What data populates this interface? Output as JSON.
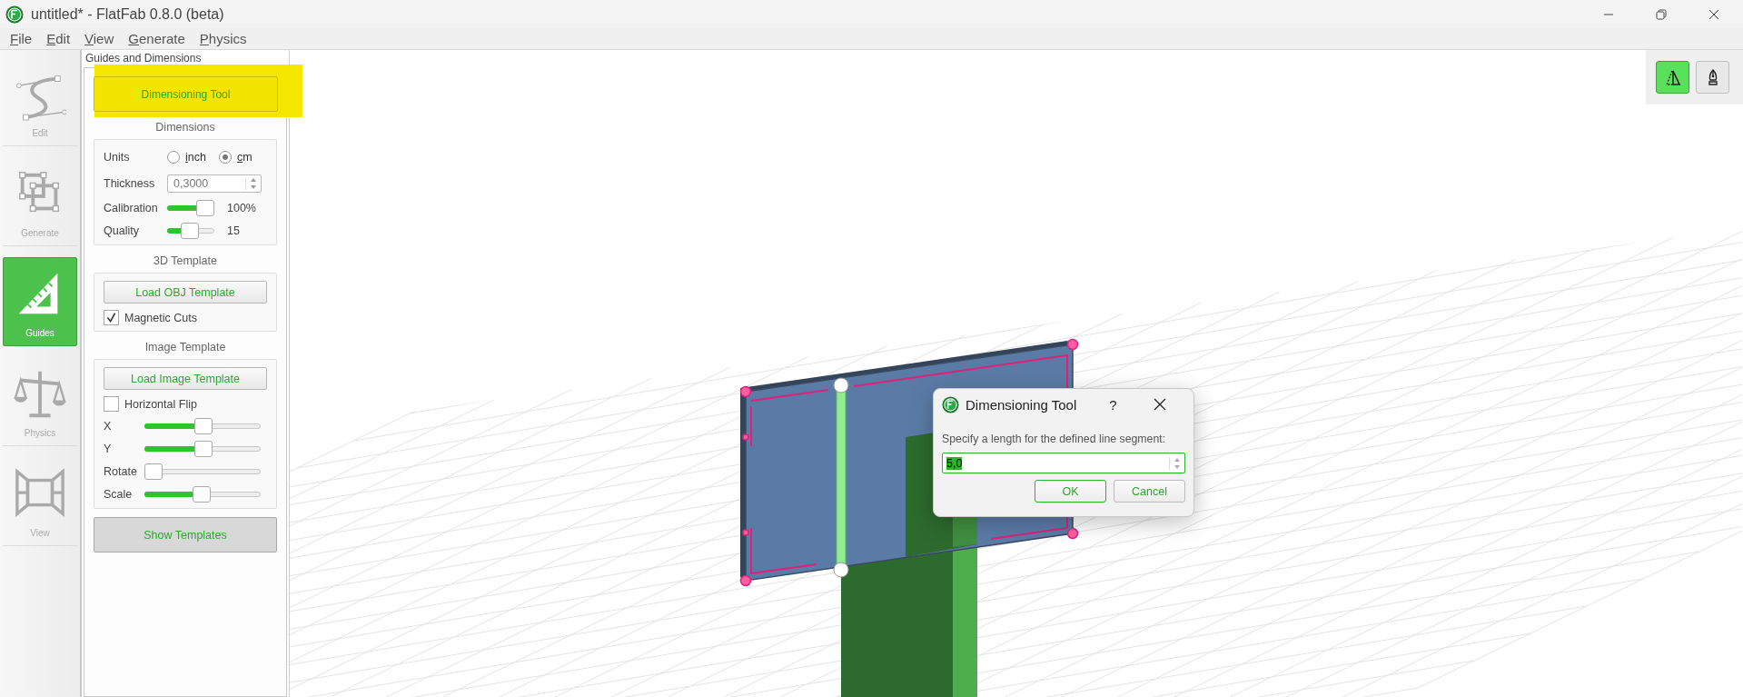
{
  "window": {
    "title": "untitled* - FlatFab 0.8.0 (beta)"
  },
  "menu": [
    {
      "label": "File"
    },
    {
      "label": "Edit"
    },
    {
      "label": "View"
    },
    {
      "label": "Generate"
    },
    {
      "label": "Physics"
    }
  ],
  "nav": [
    {
      "kind": "edit",
      "label": "Edit",
      "selected": false
    },
    {
      "kind": "generate",
      "label": "Generate",
      "selected": false
    },
    {
      "kind": "guides",
      "label": "Guides",
      "selected": true
    },
    {
      "kind": "physics",
      "label": "Physics",
      "selected": false
    },
    {
      "kind": "view",
      "label": "View",
      "selected": false
    }
  ],
  "panel": {
    "title": "Guides and Dimensions",
    "tool_button": {
      "label": "Dimensioning Tool",
      "highlighted": true
    },
    "dimensions": {
      "heading": "Dimensions",
      "units": {
        "label": "Units",
        "options": [
          {
            "label": "inch",
            "selected": false
          },
          {
            "label": "cm",
            "selected": true
          }
        ]
      },
      "thickness": {
        "label": "Thickness",
        "value": "0,3000"
      },
      "sliders": [
        {
          "label": "Calibration",
          "level": 1,
          "reading": "100%"
        },
        {
          "label": "Quality",
          "level": 0.48,
          "reading": "15"
        }
      ]
    },
    "template_3d": {
      "heading": "3D Template",
      "button": "Load OBJ Template",
      "checkbox": {
        "label": "Magnetic Cuts",
        "checked": true
      }
    },
    "image_template": {
      "heading": "Image Template",
      "button": "Load Image Template",
      "checkbox": {
        "label": "Horizontal Flip",
        "checked": false
      },
      "sliders": [
        {
          "label": "X",
          "level": 0.51
        },
        {
          "label": "Y",
          "level": 0.51
        },
        {
          "label": "Rotate",
          "level": 0
        },
        {
          "label": "Scale",
          "level": 0.49
        }
      ]
    },
    "show_button": {
      "label": "Show Templates"
    }
  },
  "toolbar": [
    {
      "kind": "cut",
      "selected": true
    },
    {
      "kind": "pen",
      "selected": false
    }
  ],
  "dialog": {
    "title": "Dimensioning Tool",
    "help": "?",
    "prompt": "Specify a length for the defined line segment:",
    "field": {
      "value": "5,0",
      "value_selected": true
    },
    "buttons": [
      {
        "label": "OK",
        "default": true
      },
      {
        "label": "Cancel",
        "default": false
      }
    ]
  }
}
